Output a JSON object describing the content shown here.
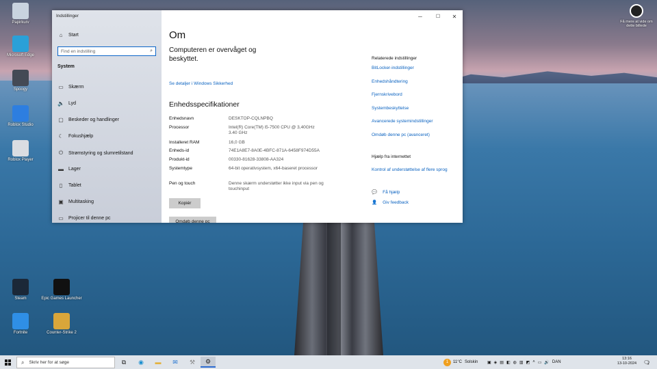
{
  "desktop": {
    "icons": [
      {
        "label": "Papirkurv",
        "icon": "recycle-bin-icon",
        "color": "#c9d3df"
      },
      {
        "label": "Microsoft Edge",
        "icon": "edge-icon",
        "color": "#2aa0d8"
      },
      {
        "label": "Spoogy",
        "icon": "app-icon",
        "color": "#444a55"
      },
      {
        "label": "Roblox Studio",
        "icon": "roblox-studio-icon",
        "color": "#2d7ee0"
      },
      {
        "label": "Roblox Player",
        "icon": "roblox-icon",
        "color": "#dadde2"
      },
      {
        "label": "Steam",
        "icon": "steam-icon",
        "color": "#1b2838"
      },
      {
        "label": "Epic Games Launcher",
        "icon": "epic-games-icon",
        "color": "#111111"
      },
      {
        "label": "Fortnite",
        "icon": "fortnite-icon",
        "color": "#2f8fe6"
      },
      {
        "label": "Counter-Strike 2",
        "icon": "cs2-icon",
        "color": "#d9a63a"
      }
    ],
    "corner": {
      "label": "Få mere at vide om dette billede",
      "icon": "learn-more-icon"
    }
  },
  "window": {
    "title": "Indstillinger",
    "controls": {
      "minimize": "─",
      "maximize": "☐",
      "close": "✕"
    }
  },
  "sidebar": {
    "home": "Start",
    "search_placeholder": "Find en indstilling",
    "section": "System",
    "items": [
      {
        "label": "Skærm",
        "icon": "display-icon",
        "glyph": "▭"
      },
      {
        "label": "Lyd",
        "icon": "sound-icon",
        "glyph": "🔈"
      },
      {
        "label": "Beskeder og handlinger",
        "icon": "notifications-icon",
        "glyph": "▢"
      },
      {
        "label": "Fokushjælp",
        "icon": "focus-assist-icon",
        "glyph": "☾"
      },
      {
        "label": "Strømstyring og slumretilstand",
        "icon": "power-icon",
        "glyph": "⏻"
      },
      {
        "label": "Lager",
        "icon": "storage-icon",
        "glyph": "▬"
      },
      {
        "label": "Tablet",
        "icon": "tablet-icon",
        "glyph": "▯"
      },
      {
        "label": "Multitasking",
        "icon": "multitasking-icon",
        "glyph": "▣"
      },
      {
        "label": "Projicer til denne pc",
        "icon": "project-icon",
        "glyph": "▭"
      }
    ]
  },
  "main": {
    "title": "Om",
    "protection": "Computeren er overvåget og beskyttet.",
    "security_link": "Se detaljer i Windows Sikkerhed",
    "specs_title": "Enhedsspecifikationer",
    "specs": [
      {
        "key": "Enhedsnavn",
        "value": "DESKTOP-CQLNPBQ"
      },
      {
        "key": "Processor",
        "value": "Intel(R) Core(TM) i5-7500 CPU @ 3,40GHz 3.40 GHz"
      },
      {
        "key": "Installeret RAM",
        "value": "16,0 GB"
      },
      {
        "key": "Enheds-id",
        "value": "74E1A8E7-8A0E-4BFC-871A-6458F974D55A"
      },
      {
        "key": "Produkt-id",
        "value": "00330-81628-33808-AA324"
      },
      {
        "key": "Systemtype",
        "value": "64-bit operativsystem, x64-baseret processor"
      },
      {
        "key": "Pen og touch",
        "value": "Denne skærm understøtter ikke input via pen og touchinput"
      }
    ],
    "copy_button": "Kopiér",
    "rename_button": "Omdøb denne pc"
  },
  "related": {
    "title": "Relaterede indstillinger",
    "links": [
      "BitLocker-indstillinger",
      "Enhedshåndtering",
      "Fjernskrivebord",
      "Systembeskyttelse",
      "Avancerede systemindstillinger",
      "Omdøb denne pc (avanceret)"
    ],
    "help_title": "Hjælp fra internettet",
    "help_link": "Kontrol af understøttelse af flere sprog",
    "get_help": "Få hjælp",
    "feedback": "Giv feedback"
  },
  "taskbar": {
    "search_placeholder": "Skriv her for at søge",
    "weather_temp": "11°C",
    "weather_text": "Solskin",
    "weather_badge": "1",
    "language": "DAN",
    "time": "13:16",
    "date": "13-10-2024",
    "notification_count": "2"
  }
}
